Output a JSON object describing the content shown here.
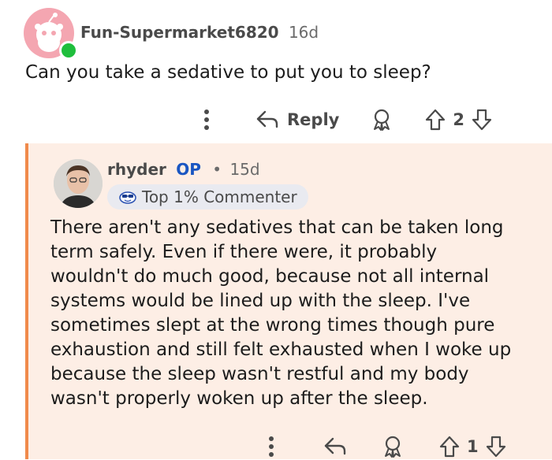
{
  "comment": {
    "username": "Fun-Supermarket6820",
    "age": "16d",
    "body": "Can you take a sedative to put you to sleep?",
    "reply_label": "Reply",
    "vote_count": "2",
    "icons": [
      "more-options-icon",
      "reply-arrow-icon",
      "award-icon",
      "upvote-icon",
      "downvote-icon"
    ],
    "avatar_color": "#f4a6b1",
    "online_color": "#1fbe3c"
  },
  "reply": {
    "username": "rhyder",
    "op_label": "OP",
    "separator": "•",
    "age": "15d",
    "badge": "Top 1% Commenter",
    "body": "There aren't any sedatives that can be taken long\nterm safely. Even if there were, it probably\nwouldn't do much good, because not all internal\nsystems would be lined up with the sleep. I've\nsometimes slept at the wrong times though pure\nexhaustion and still felt exhausted when I woke up\nbecause the sleep wasn't restful and my body\nwasn't properly woken up after the sleep.",
    "vote_count": "1",
    "thread_line_color": "#f08a4b",
    "background_color": "#fdeee5"
  }
}
